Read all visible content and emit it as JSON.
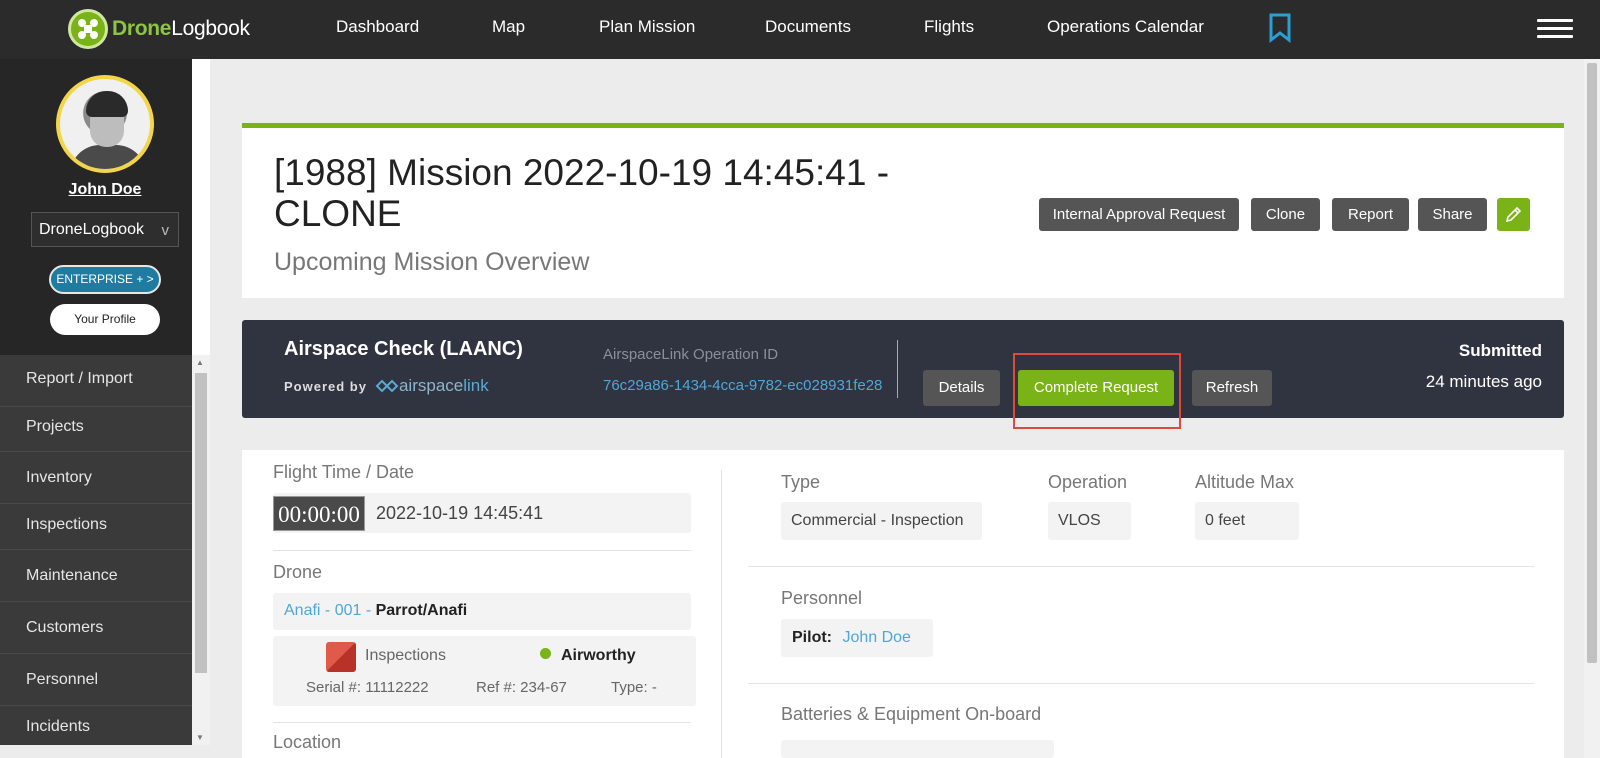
{
  "nav": {
    "logo_part1": "Drone",
    "logo_part2": "Logbook",
    "items": [
      "Dashboard",
      "Map",
      "Plan Mission",
      "Documents",
      "Flights",
      "Operations Calendar"
    ]
  },
  "sidebar": {
    "user_name": "John Doe",
    "org": "DroneLogbook",
    "org_chevron": "v",
    "plan_label": "ENTERPRISE + >",
    "profile_label": "Your Profile",
    "menu": [
      "Report / Import",
      "Projects",
      "Inventory",
      "Inspections",
      "Maintenance",
      "Customers",
      "Personnel",
      "Incidents"
    ]
  },
  "header": {
    "title": "[1988] Mission 2022-10-19 14:45:41 - CLONE",
    "subtitle": "Upcoming Mission Overview",
    "buttons": [
      "Internal Approval Request",
      "Clone",
      "Report",
      "Share"
    ],
    "edit_icon": "pencil-icon"
  },
  "laanc": {
    "title": "Airspace Check (LAANC)",
    "powered_by": "Powered by",
    "brand_a": "airspace",
    "brand_b": "link",
    "op_label": "AirspaceLink Operation ID",
    "op_id": "76c29a86-1434-4cca-9782-ec028931fe28",
    "btn_details": "Details",
    "btn_complete": "Complete Request",
    "btn_refresh": "Refresh",
    "status": "Submitted",
    "status_time": "24 minutes ago"
  },
  "details": {
    "flight_time_label": "Flight Time / Date",
    "timer": "00:00:00",
    "datetime": "2022-10-19 14:45:41",
    "drone_label": "Drone",
    "drone_name": "Anafi - 001",
    "drone_sep": " - ",
    "drone_model": "Parrot/Anafi",
    "inspections_label": "Inspections",
    "airworthy": "Airworthy",
    "serial": "Serial #: 11112222",
    "ref": "Ref #: 234-67",
    "type_short": "Type: -",
    "location_label": "Location",
    "type_label": "Type",
    "type_value": "Commercial - Inspection",
    "operation_label": "Operation",
    "operation_value": "VLOS",
    "altitude_label": "Altitude Max",
    "altitude_value": "0 feet",
    "personnel_label": "Personnel",
    "pilot_label": "Pilot:",
    "pilot_name": "John Doe",
    "batteries_label": "Batteries & Equipment On-board"
  },
  "colors": {
    "accent_green": "#7ab317",
    "link_blue": "#4fa7d8",
    "nav_bg": "#2b2b2b",
    "laanc_bg": "#2f3440",
    "highlight_red": "#e04a3a"
  }
}
